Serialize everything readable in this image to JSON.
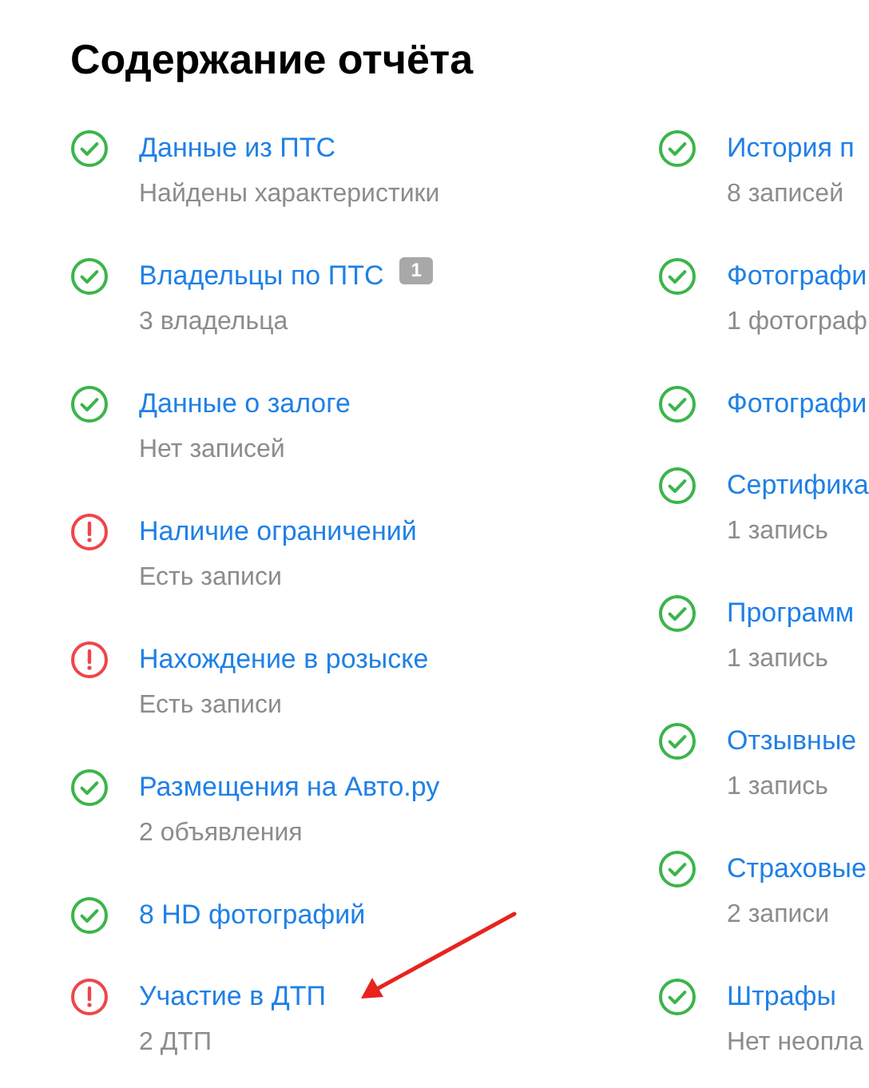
{
  "title": "Содержание отчёта",
  "columns": [
    {
      "items": [
        {
          "kind": "ok",
          "title": "Данные из ПТС",
          "subtitle": "Найдены характеристики"
        },
        {
          "kind": "ok",
          "title": "Владельцы по ПТС",
          "badge": "1",
          "subtitle": "3 владельца"
        },
        {
          "kind": "ok",
          "title": "Данные о залоге",
          "subtitle": "Нет записей"
        },
        {
          "kind": "warning",
          "title": "Наличие ограничений",
          "subtitle": "Есть записи"
        },
        {
          "kind": "warning",
          "title": "Нахождение в розыске",
          "subtitle": "Есть записи"
        },
        {
          "kind": "ok",
          "title": "Размещения на Авто.ру",
          "subtitle": "2 объявления"
        },
        {
          "kind": "ok",
          "title": "8 HD фотографий"
        },
        {
          "kind": "warning",
          "title": "Участие в ДТП",
          "subtitle": "2 ДТП"
        }
      ]
    },
    {
      "items": [
        {
          "kind": "ok",
          "title": "История п",
          "subtitle": "8 записей"
        },
        {
          "kind": "ok",
          "title": "Фотографи",
          "subtitle": "1 фотограф"
        },
        {
          "kind": "ok",
          "title": "Фотографи"
        },
        {
          "kind": "ok",
          "title": "Сертифика",
          "subtitle": "1 запись"
        },
        {
          "kind": "ok",
          "title": "Программ",
          "subtitle": "1 запись"
        },
        {
          "kind": "ok",
          "title": "Отзывные",
          "subtitle": "1 запись"
        },
        {
          "kind": "ok",
          "title": "Страховые",
          "subtitle": "2 записи"
        },
        {
          "kind": "ok",
          "title": "Штрафы",
          "subtitle": "Нет неопла"
        }
      ]
    }
  ]
}
